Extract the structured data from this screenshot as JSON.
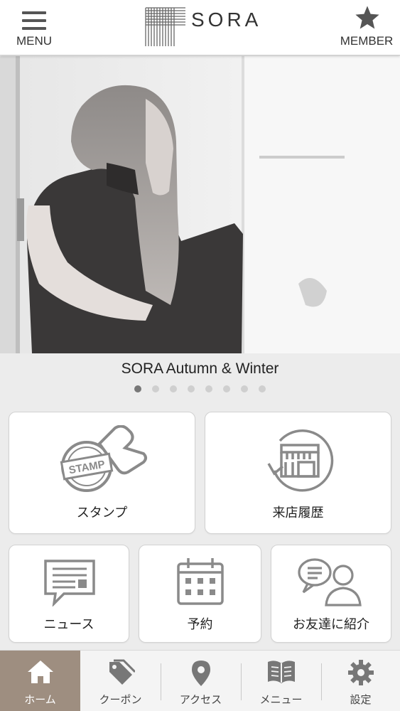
{
  "header": {
    "menu_label": "MENU",
    "logo_text": "SORA",
    "member_label": "MEMBER"
  },
  "carousel": {
    "caption": "SORA Autumn & Winter",
    "slide_count": 8,
    "active_index": 0
  },
  "tiles": {
    "stamp": {
      "label": "スタンプ",
      "icon_text": "STAMP"
    },
    "history": {
      "label": "来店履歴"
    },
    "news": {
      "label": "ニュース"
    },
    "reserve": {
      "label": "予約"
    },
    "invite": {
      "label": "お友達に紹介"
    }
  },
  "tabbar": {
    "items": [
      {
        "label": "ホーム",
        "icon": "home-icon",
        "active": true
      },
      {
        "label": "クーポン",
        "icon": "coupon-tag-icon",
        "active": false
      },
      {
        "label": "アクセス",
        "icon": "map-pin-icon",
        "active": false
      },
      {
        "label": "メニュー",
        "icon": "book-icon",
        "active": false
      },
      {
        "label": "設定",
        "icon": "gear-icon",
        "active": false
      }
    ]
  },
  "colors": {
    "active_tab": "#9e8e80",
    "icon_gray": "#8a8a8a",
    "header_bg": "#ffffff",
    "page_bg": "#ececec"
  }
}
